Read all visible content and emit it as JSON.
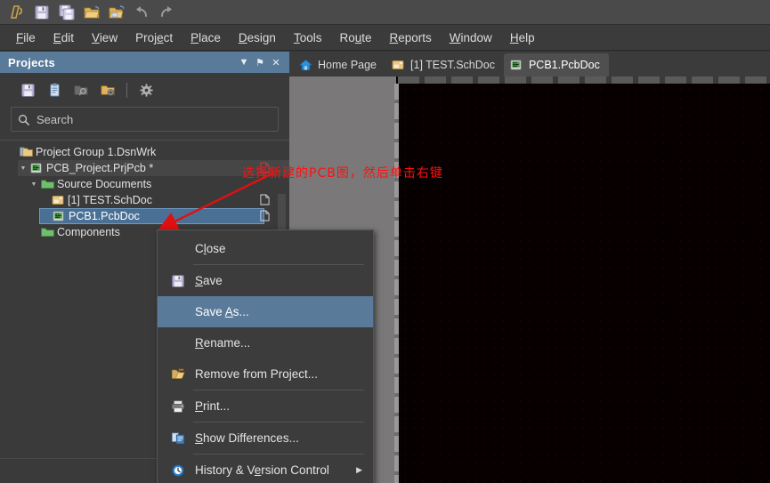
{
  "toolbar": {
    "buttons": [
      {
        "name": "altium-logo-icon",
        "label": "Altium"
      },
      {
        "name": "save-icon",
        "label": "Save"
      },
      {
        "name": "save-all-icon",
        "label": "Save All"
      },
      {
        "name": "open-folder-icon",
        "label": "Open"
      },
      {
        "name": "open-project-icon",
        "label": "Open Project"
      },
      {
        "name": "undo-icon",
        "label": "Undo"
      },
      {
        "name": "redo-icon",
        "label": "Redo"
      }
    ]
  },
  "menubar": {
    "items": [
      {
        "pre": "",
        "key": "F",
        "post": "ile"
      },
      {
        "pre": "",
        "key": "E",
        "post": "dit"
      },
      {
        "pre": "",
        "key": "V",
        "post": "iew"
      },
      {
        "pre": "Proj",
        "key": "e",
        "post": "ct"
      },
      {
        "pre": "",
        "key": "P",
        "post": "lace"
      },
      {
        "pre": "",
        "key": "D",
        "post": "esign"
      },
      {
        "pre": "",
        "key": "T",
        "post": "ools"
      },
      {
        "pre": "Ro",
        "key": "u",
        "post": "te"
      },
      {
        "pre": "",
        "key": "R",
        "post": "eports"
      },
      {
        "pre": "",
        "key": "W",
        "post": "indow"
      },
      {
        "pre": "",
        "key": "H",
        "post": "elp"
      }
    ]
  },
  "panel": {
    "title": "Projects",
    "header_buttons": [
      {
        "name": "panel-dropdown-icon",
        "glyph": "▼"
      },
      {
        "name": "panel-pin-icon",
        "glyph": "⚑"
      },
      {
        "name": "panel-close-icon",
        "glyph": "✕"
      }
    ],
    "toolbar_buttons": [
      {
        "name": "panel-save-icon",
        "label": "Save"
      },
      {
        "name": "panel-compile-icon",
        "label": "Compile"
      },
      {
        "name": "panel-folder-search-icon",
        "label": "Browse"
      },
      {
        "name": "panel-folder-options-icon",
        "label": "Project Options"
      },
      {
        "name": "panel-settings-gear-icon",
        "label": "Settings"
      }
    ],
    "search": {
      "placeholder": "Search",
      "value": ""
    },
    "tree": [
      {
        "label": "Project Group 1.DsnWrk",
        "indent": 0,
        "icon": "workspace-icon",
        "arrow": "",
        "state": "normal",
        "doc": false
      },
      {
        "label": "PCB_Project.PrjPcb *",
        "indent": 1,
        "icon": "project-icon",
        "arrow": "▼",
        "state": "soft",
        "doc": true
      },
      {
        "label": "Source Documents",
        "indent": 2,
        "icon": "folder-icon",
        "arrow": "▼",
        "state": "normal",
        "doc": false
      },
      {
        "label": "[1] TEST.SchDoc",
        "indent": 3,
        "icon": "sch-icon",
        "arrow": "",
        "state": "normal",
        "doc": true
      },
      {
        "label": "PCB1.PcbDoc",
        "indent": 3,
        "icon": "pcb-icon",
        "arrow": "",
        "state": "selected",
        "doc": true
      },
      {
        "label": "Components",
        "indent": 2,
        "icon": "folder-icon",
        "arrow": "",
        "state": "normal",
        "doc": false
      }
    ]
  },
  "tabs": [
    {
      "label": "Home Page",
      "icon": "home-icon",
      "active": false
    },
    {
      "label": "[1] TEST.SchDoc",
      "icon": "sch-icon",
      "active": false
    },
    {
      "label": "PCB1.PcbDoc",
      "icon": "pcb-icon",
      "active": true
    }
  ],
  "context_menu": {
    "items": [
      {
        "pre": "C",
        "key": "l",
        "post": "ose",
        "icon": "",
        "highlight": false,
        "submenu": false,
        "sep_after": true
      },
      {
        "pre": "",
        "key": "S",
        "post": "ave",
        "icon": "save-icon",
        "highlight": false,
        "submenu": false,
        "sep_after": false
      },
      {
        "pre": "Save ",
        "key": "A",
        "post": "s...",
        "icon": "",
        "highlight": true,
        "submenu": false,
        "sep_after": false
      },
      {
        "pre": "",
        "key": "R",
        "post": "ename...",
        "icon": "",
        "highlight": false,
        "submenu": false,
        "sep_after": false
      },
      {
        "pre": "Remove from Project...",
        "key": "",
        "post": "",
        "icon": "remove-from-project-icon",
        "highlight": false,
        "submenu": false,
        "sep_after": true
      },
      {
        "pre": "",
        "key": "P",
        "post": "rint...",
        "icon": "print-icon",
        "highlight": false,
        "submenu": false,
        "sep_after": true
      },
      {
        "pre": "",
        "key": "S",
        "post": "how Differences...",
        "icon": "show-differences-icon",
        "highlight": false,
        "submenu": false,
        "sep_after": true
      },
      {
        "pre": "History & V",
        "key": "e",
        "post": "rsion Control",
        "icon": "history-clock-icon",
        "highlight": false,
        "submenu": true,
        "sep_after": false
      }
    ]
  },
  "annotation": {
    "text": "选择新建的PCB图，然后单击右键",
    "color": "#ff1010"
  },
  "colors": {
    "panel_header": "#5a7a9a",
    "selection": "#4a7096",
    "menu_highlight": "#5a7a9a",
    "canvas": "#050505",
    "toolbar_bg": "#4a4a4a"
  }
}
